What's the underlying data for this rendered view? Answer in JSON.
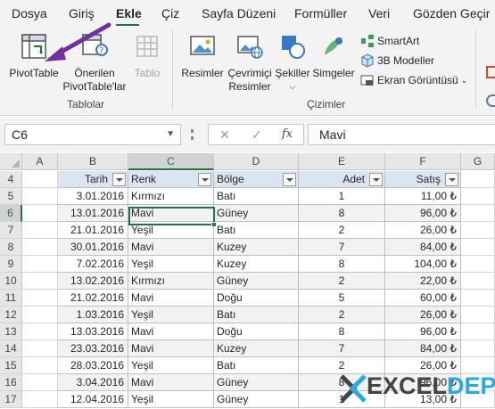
{
  "ribbon_tabs": [
    "Dosya",
    "Giriş",
    "Ekle",
    "Çiz",
    "Sayfa Düzeni",
    "Formüller",
    "Veri",
    "Gözden Geçir"
  ],
  "active_tab": "Ekle",
  "groups": {
    "tablolar": {
      "label": "Tablolar",
      "pivottable": "PivotTable",
      "recommended_line1": "Önerilen",
      "recommended_line2": "PivotTable'lar",
      "table": "Tablo"
    },
    "cizimler": {
      "label": "Çizimler",
      "resimler": "Resimler",
      "online_line1": "Çevrimiçi",
      "online_line2": "Resimler",
      "sekiller": "Şekiller",
      "simgeler": "Simgeler",
      "smartart": "SmartArt",
      "models3d": "3B Modeller",
      "screenshot": "Ekran Görüntüsü"
    }
  },
  "namebox": "C6",
  "formula_value": "Mavi",
  "fx_label": "fx",
  "columns": [
    "A",
    "B",
    "C",
    "D",
    "E",
    "F",
    "G"
  ],
  "selected_column": "C",
  "selected_row": "6",
  "table": {
    "headers": [
      "Tarih",
      "Renk",
      "Bölge",
      "Adet",
      "Satış"
    ],
    "rows": [
      {
        "row": "5",
        "tarih": "3.01.2016",
        "renk": "Kırmızı",
        "bolge": "Batı",
        "adet": "1",
        "satis": "11,00 ₺"
      },
      {
        "row": "6",
        "tarih": "13.01.2016",
        "renk": "Mavi",
        "bolge": "Güney",
        "adet": "8",
        "satis": "96,00 ₺"
      },
      {
        "row": "7",
        "tarih": "21.01.2016",
        "renk": "Yeşil",
        "bolge": "Batı",
        "adet": "2",
        "satis": "26,00 ₺"
      },
      {
        "row": "8",
        "tarih": "30.01.2016",
        "renk": "Mavi",
        "bolge": "Kuzey",
        "adet": "7",
        "satis": "84,00 ₺"
      },
      {
        "row": "9",
        "tarih": "7.02.2016",
        "renk": "Yeşil",
        "bolge": "Kuzey",
        "adet": "8",
        "satis": "104,00 ₺"
      },
      {
        "row": "10",
        "tarih": "13.02.2016",
        "renk": "Kırmızı",
        "bolge": "Güney",
        "adet": "2",
        "satis": "22,00 ₺"
      },
      {
        "row": "11",
        "tarih": "21.02.2016",
        "renk": "Mavi",
        "bolge": "Doğu",
        "adet": "5",
        "satis": "60,00 ₺"
      },
      {
        "row": "12",
        "tarih": "1.03.2016",
        "renk": "Yeşil",
        "bolge": "Batı",
        "adet": "2",
        "satis": "26,00 ₺"
      },
      {
        "row": "13",
        "tarih": "13.03.2016",
        "renk": "Mavi",
        "bolge": "Doğu",
        "adet": "8",
        "satis": "96,00 ₺"
      },
      {
        "row": "14",
        "tarih": "23.03.2016",
        "renk": "Mavi",
        "bolge": "Kuzey",
        "adet": "7",
        "satis": "84,00 ₺"
      },
      {
        "row": "15",
        "tarih": "28.03.2016",
        "renk": "Yeşil",
        "bolge": "Batı",
        "adet": "2",
        "satis": "26,00 ₺"
      },
      {
        "row": "16",
        "tarih": "3.04.2016",
        "renk": "Mavi",
        "bolge": "Güney",
        "adet": "8",
        "satis": "96,00 ₺"
      },
      {
        "row": "17",
        "tarih": "12.04.2016",
        "renk": "Yeşil",
        "bolge": "Güney",
        "adet": "1",
        "satis": "13,00 ₺"
      }
    ]
  },
  "header_row": "4",
  "logo": {
    "part1": "EXCEL",
    "part2": "DEPO"
  },
  "colors": {
    "accent": "#217346",
    "header_fill": "#dbe4f1",
    "band_fill": "#f2f2f2",
    "arrow": "#7030a0"
  }
}
